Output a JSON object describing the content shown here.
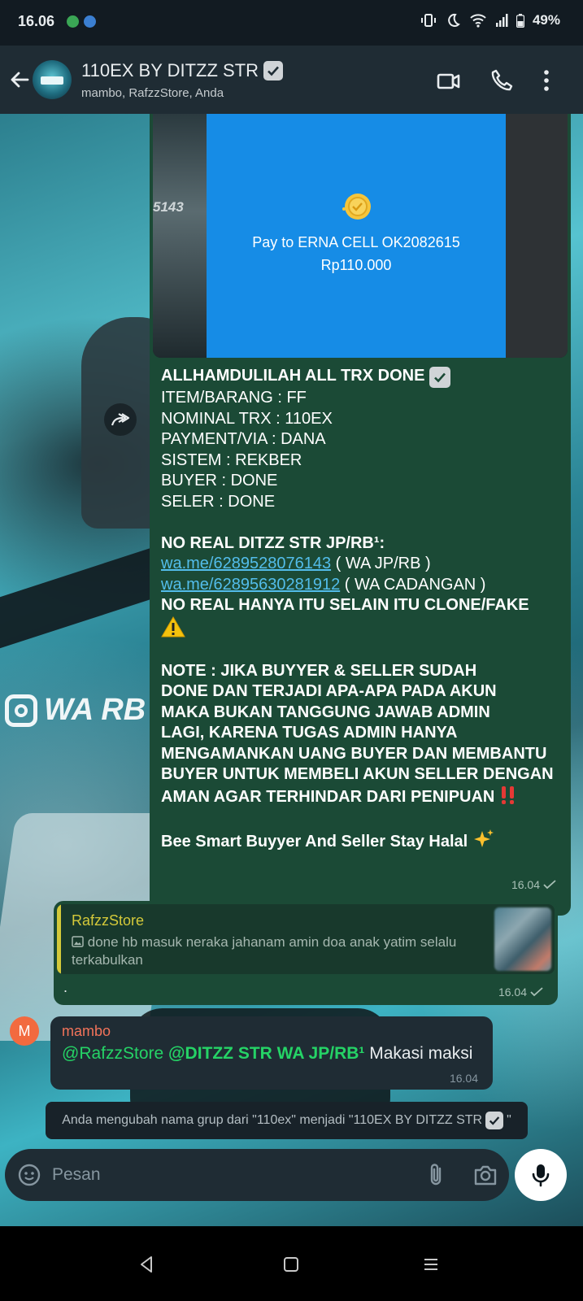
{
  "status_bar": {
    "time": "16.06",
    "battery": "49%"
  },
  "header": {
    "title": "110EX BY DITZZ STR",
    "subtitle": "mambo, RafzzStore, Anda"
  },
  "payment_image": {
    "side_text": "5143",
    "pay_to": "Pay to ERNA CELL OK2082615",
    "amount": "Rp110.000"
  },
  "main_message": {
    "headline": "ALLHAMDULILAH ALL TRX DONE",
    "lines": [
      "ITEM/BARANG : FF",
      "NOMINAL TRX : 110EX",
      "PAYMENT/VIA : DANA",
      "SISTEM : REKBER",
      "BUYER : DONE",
      "SELER : DONE"
    ],
    "no_real_title": "NO REAL DITZZ STR JP/RB¹:",
    "link1": "wa.me/6289528076143",
    "link1_note": " ( WA JP/RB )",
    "link2": "wa.me/62895630281912",
    "link2_note": " ( WA CADANGAN )",
    "warning": "NO REAL HANYA ITU SELAIN ITU CLONE/FAKE",
    "note_lines": [
      "NOTE : JIKA BUYYER & SELLER SUDAH",
      "DONE DAN TERJADI APA-APA PADA AKUN",
      "MAKA BUKAN TANGGUNG JAWAB ADMIN",
      "LAGI, KARENA TUGAS ADMIN HANYA",
      "MENGAMANKAN UANG BUYER DAN MEMBANTU",
      "BUYER UNTUK MEMBELI AKUN SELLER DENGAN",
      "AMAN AGAR TERHINDAR DARI PENIPUAN"
    ],
    "closing": "Bee Smart Buyyer And Seller Stay Halal",
    "time": "16.04"
  },
  "reply_message": {
    "quoted_name": "RafzzStore",
    "quoted_text": "done hb masuk neraka jahanam amin doa anak yatim selalu terkabulkan",
    "text": ".",
    "time": "16.04"
  },
  "incoming_message": {
    "avatar_letter": "M",
    "sender": "mambo",
    "mention1": "@RafzzStore",
    "mention2": "@DITZZ STR WA JP/RB¹",
    "text": " Makasi maksi",
    "time": "16.04"
  },
  "system_notice": {
    "text": "Anda mengubah nama grup dari \"110ex\" menjadi \"110EX BY DITZZ STR",
    "suffix": "\""
  },
  "input": {
    "placeholder": "Pesan"
  },
  "background": {
    "watermark": "WA RB :"
  },
  "colors": {
    "header_bg": "#1f2c34",
    "outgoing_bubble": "#1b4a36",
    "link": "#53bdeb",
    "mention": "#25d366",
    "sender_name": "#f2735a",
    "quote_accent": "#d4c93a"
  }
}
